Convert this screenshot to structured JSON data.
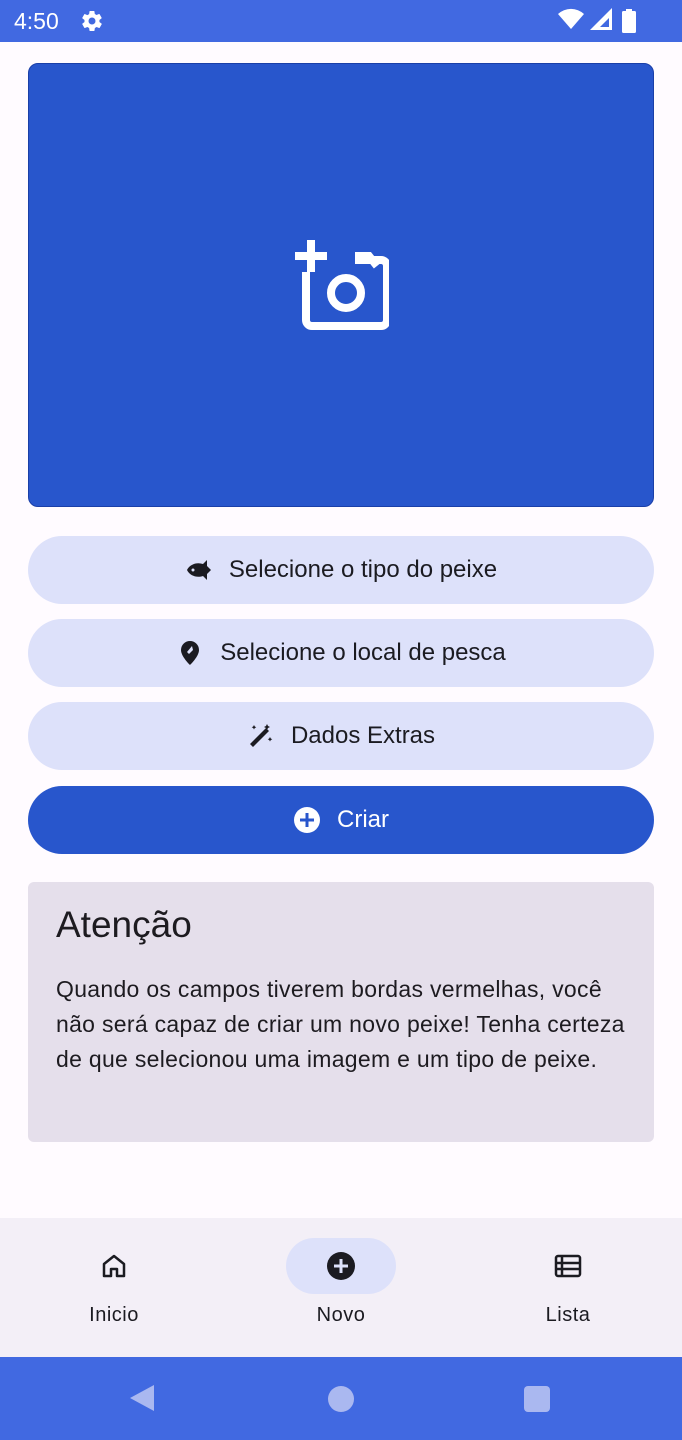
{
  "status_bar": {
    "time": "4:50"
  },
  "photo_picker": {
    "icon": "add-a-photo-icon"
  },
  "actions": {
    "fish_type": {
      "label": "Selecione o tipo do peixe",
      "icon": "fish-icon"
    },
    "location": {
      "label": "Selecione o local de pesca",
      "icon": "location-pin-icon"
    },
    "extras": {
      "label": "Dados Extras",
      "icon": "magic-wand-icon"
    },
    "create": {
      "label": "Criar",
      "icon": "add-circle-icon"
    }
  },
  "notice": {
    "title": "Atenção",
    "text": "Quando os campos tiverem bordas vermelhas, você não será capaz de criar um novo peixe! Tenha certeza de que selecionou uma imagem e um tipo de peixe."
  },
  "bottom_nav": {
    "items": [
      {
        "label": "Inicio",
        "icon": "home-icon",
        "active": false
      },
      {
        "label": "Novo",
        "icon": "add-circle-icon",
        "active": true
      },
      {
        "label": "Lista",
        "icon": "list-icon",
        "active": false
      }
    ]
  },
  "colors": {
    "primary": "#2856cc",
    "status_bar": "#4169e1",
    "tonal": "#dde1fa",
    "notice_bg": "#e5dfeb"
  }
}
